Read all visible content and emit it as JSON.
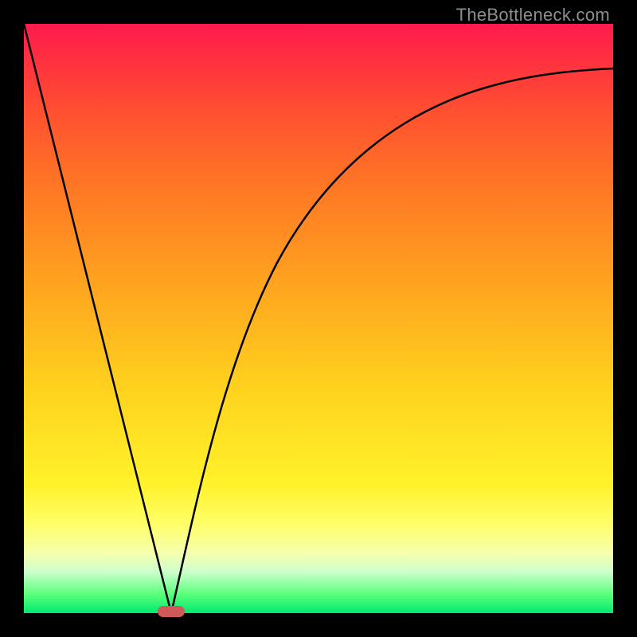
{
  "watermark": "TheBottleneck.com",
  "colors": {
    "frame": "#000000",
    "gradient_top": "#ff1a4d",
    "gradient_mid": "#ffd21e",
    "gradient_bottom": "#00e870",
    "curve": "#000000",
    "marker": "#d05a5a"
  },
  "chart_data": {
    "type": "line",
    "title": "",
    "xlabel": "",
    "ylabel": "",
    "xlim": [
      0,
      100
    ],
    "ylim": [
      0,
      100
    ],
    "series": [
      {
        "name": "left-descent",
        "x": [
          0,
          5,
          10,
          15,
          18,
          20,
          22,
          24,
          25
        ],
        "values": [
          100,
          80,
          60,
          40,
          28,
          20,
          12,
          4,
          0
        ]
      },
      {
        "name": "right-ascent",
        "x": [
          25,
          27,
          29,
          31,
          34,
          38,
          43,
          50,
          58,
          68,
          80,
          92,
          100
        ],
        "values": [
          0,
          8,
          18,
          28,
          40,
          52,
          63,
          73,
          80,
          85,
          89,
          91,
          92
        ]
      }
    ],
    "annotations": [
      {
        "name": "minimum-marker",
        "x": 25,
        "y": 0
      }
    ],
    "grid": false,
    "legend": false
  }
}
